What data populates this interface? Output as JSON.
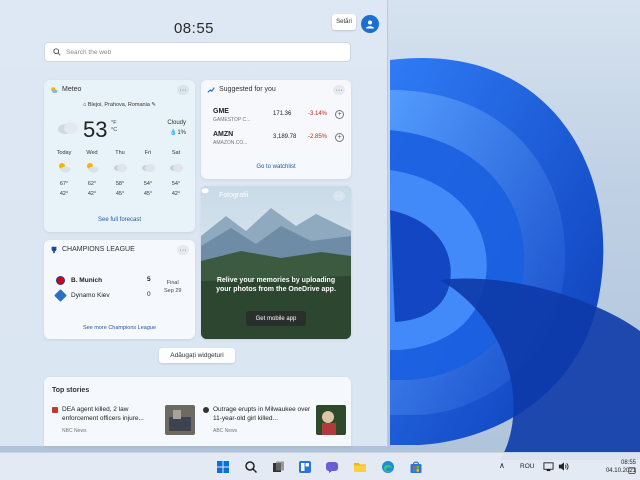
{
  "widgets": {
    "time": "08:55",
    "settings_label": "Setări",
    "search_placeholder": "Search the web",
    "weather": {
      "title": "Meteo",
      "location": "Blejoi, Prahova, Romania",
      "temperature": "53",
      "unit_f": "°F",
      "unit_c": "°C",
      "condition": "Cloudy",
      "precip": "1%",
      "forecast": [
        {
          "day": "Today",
          "high": "67°",
          "low": "42°",
          "icon": "partly-sunny-icon"
        },
        {
          "day": "Wed",
          "high": "62°",
          "low": "42°",
          "icon": "partly-sunny-icon"
        },
        {
          "day": "Thu",
          "high": "58°",
          "low": "45°",
          "icon": "cloudy-icon"
        },
        {
          "day": "Fri",
          "high": "54°",
          "low": "45°",
          "icon": "cloudy-icon"
        },
        {
          "day": "Sat",
          "high": "54°",
          "low": "42°",
          "icon": "cloudy-icon"
        }
      ],
      "link": "See full forecast"
    },
    "suggested": {
      "title": "Suggested for you",
      "stocks": [
        {
          "symbol": "GME",
          "name": "GAMESTOP C...",
          "price": "171.36",
          "change": "-3.14%"
        },
        {
          "symbol": "AMZN",
          "name": "AMAZON.CO...",
          "price": "3,189.78",
          "change": "-2.85%"
        }
      ],
      "link": "Go to watchlist"
    },
    "photos": {
      "title": "Fotografii",
      "text": "Relive your memories by uploading your photos from the OneDrive app.",
      "button": "Get mobile app"
    },
    "sports": {
      "title": "CHAMPIONS LEAGUE",
      "home_team": "B. Munich",
      "home_score": "5",
      "away_team": "Dynamo Kiev",
      "away_score": "0",
      "status": "Final",
      "date": "Sep 29",
      "link": "See more Champions League"
    },
    "add_widgets": "Adăugați widgeturi",
    "top_stories": {
      "title": "Top stories",
      "items": [
        {
          "headline": "DEA agent killed, 2 law enforcement officers injure...",
          "source": "NBC News"
        },
        {
          "headline": "Outrage erupts in Milwaukee over 11-year-old girl killed...",
          "source": "ABC News"
        }
      ]
    }
  },
  "taskbar": {
    "language": "ROU",
    "time": "08:55",
    "date": "04.10.2021"
  },
  "colors": {
    "accent": "#1a6fd1",
    "negative": "#c42b1c",
    "link": "#1e5aa8"
  }
}
